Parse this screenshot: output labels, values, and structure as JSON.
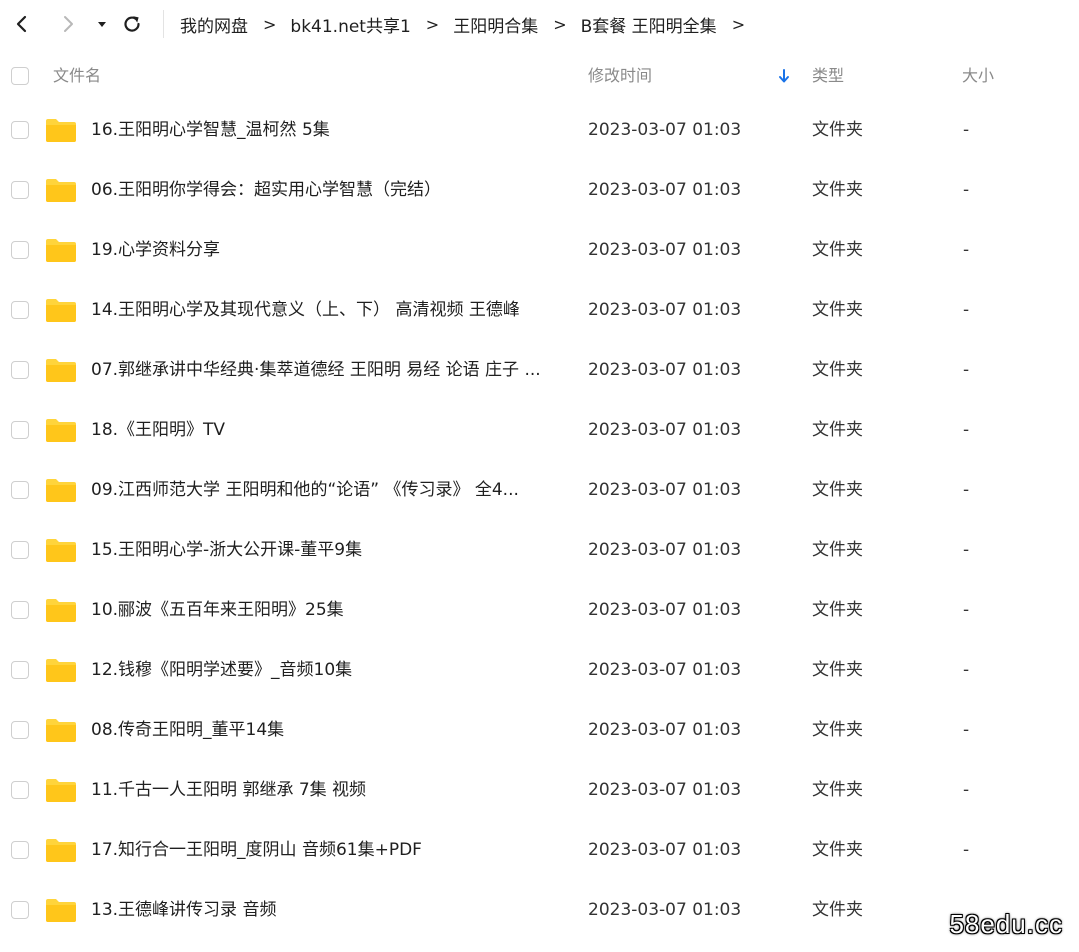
{
  "nav": {
    "breadcrumb": [
      "我的网盘",
      "bk41.net共享1",
      "王阳明合集",
      "B套餐 王阳明全集"
    ],
    "separator": ">",
    "icons": [
      "chevron-left-icon",
      "chevron-right-icon",
      "caret-down-icon",
      "refresh-icon"
    ]
  },
  "header": {
    "name": "文件名",
    "mtime": "修改时间",
    "type": "类型",
    "size": "大小",
    "sort_icon": "arrow-down-icon",
    "sort_color": "#1a73e8"
  },
  "files": [
    {
      "name": "16.王阳明心学智慧_温柯然 5集",
      "mtime": "2023-03-07 01:03",
      "type": "文件夹",
      "size": "-"
    },
    {
      "name": "06.王阳明你学得会：超实用心学智慧（完结）",
      "mtime": "2023-03-07 01:03",
      "type": "文件夹",
      "size": "-"
    },
    {
      "name": "19.心学资料分享",
      "mtime": "2023-03-07 01:03",
      "type": "文件夹",
      "size": "-"
    },
    {
      "name": "14.王阳明心学及其现代意义（上、下） 高清视频  王德峰",
      "mtime": "2023-03-07 01:03",
      "type": "文件夹",
      "size": "-"
    },
    {
      "name": "07.郭继承讲中华经典·集萃道德经 王阳明 易经 论语 庄子 ...",
      "mtime": "2023-03-07 01:03",
      "type": "文件夹",
      "size": "-"
    },
    {
      "name": "18.《王阳明》TV",
      "mtime": "2023-03-07 01:03",
      "type": "文件夹",
      "size": "-"
    },
    {
      "name": "09.江西师范大学 王阳明和他的“论语” 《传习录》 全4...",
      "mtime": "2023-03-07 01:03",
      "type": "文件夹",
      "size": "-"
    },
    {
      "name": "15.王阳明心学-浙大公开课-董平9集",
      "mtime": "2023-03-07 01:03",
      "type": "文件夹",
      "size": "-"
    },
    {
      "name": "10.郦波《五百年来王阳明》25集",
      "mtime": "2023-03-07 01:03",
      "type": "文件夹",
      "size": "-"
    },
    {
      "name": "12.钱穆《阳明学述要》_音频10集",
      "mtime": "2023-03-07 01:03",
      "type": "文件夹",
      "size": "-"
    },
    {
      "name": "08.传奇王阳明_董平14集",
      "mtime": "2023-03-07 01:03",
      "type": "文件夹",
      "size": "-"
    },
    {
      "name": "11.千古一人王阳明 郭继承 7集 视频",
      "mtime": "2023-03-07 01:03",
      "type": "文件夹",
      "size": "-"
    },
    {
      "name": "17.知行合一王阳明_度阴山 音频61集+PDF",
      "mtime": "2023-03-07 01:03",
      "type": "文件夹",
      "size": "-"
    },
    {
      "name": "13.王德峰讲传习录 音频",
      "mtime": "2023-03-07 01:03",
      "type": "文件夹",
      "size": ""
    }
  ],
  "folder_icon": "folder-icon",
  "folder_color": "#ffd43b",
  "watermark": "58edu.cc"
}
